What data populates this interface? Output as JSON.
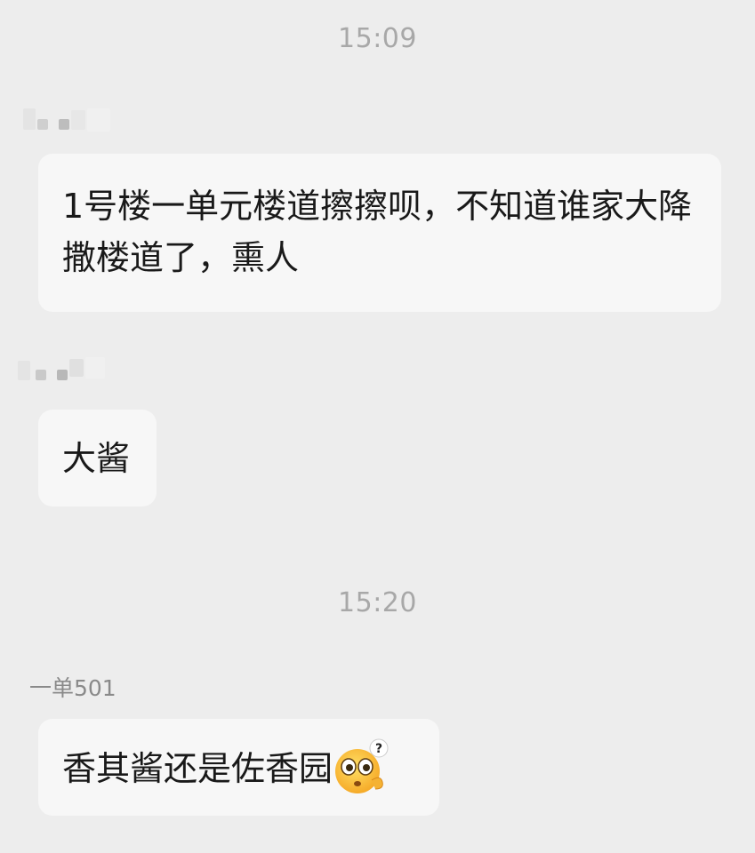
{
  "chat": {
    "timestamps": [
      "15:09",
      "15:20"
    ],
    "messages": [
      {
        "sender_name": "",
        "sender_obscured": true,
        "text": "1号楼一单元楼道擦擦呗，不知道谁家大降撒楼道了，熏人"
      },
      {
        "sender_name": "",
        "sender_obscured": true,
        "text": "大酱"
      },
      {
        "sender_name": "一单501",
        "sender_obscured": false,
        "text": "香其酱还是佐香园",
        "emoji": "confused-question-face-icon"
      }
    ]
  },
  "colors": {
    "background": "#ededed",
    "bubble": "#f7f7f7",
    "timestamp": "#a8a8a8",
    "sender_name": "#8a8a8a",
    "message_text": "#191919"
  }
}
